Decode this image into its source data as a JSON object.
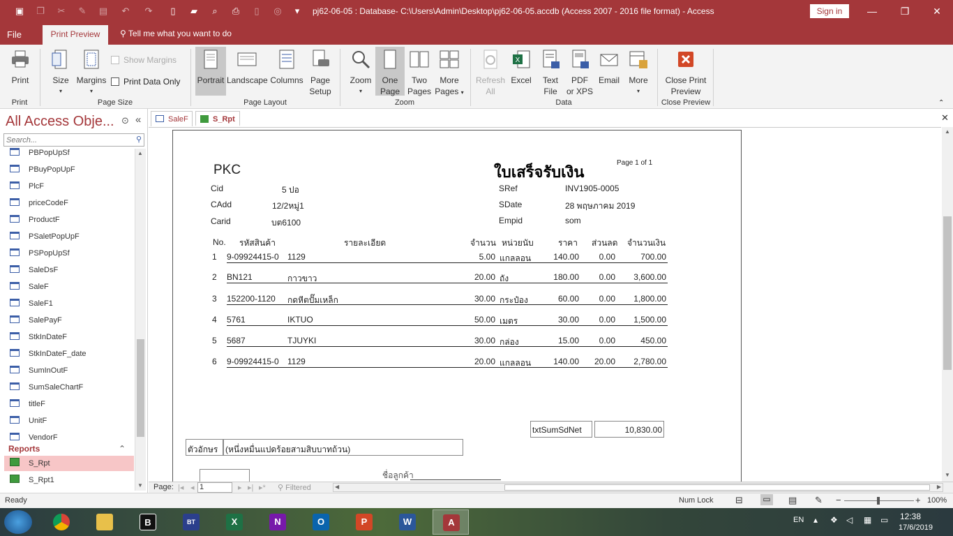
{
  "titlebar": {
    "title": "pj62-06-05 : Database- C:\\Users\\Admin\\Desktop\\pj62-06-05.accdb (Access 2007 - 2016 file format)  -  Access",
    "sign_in": "Sign in"
  },
  "tabs": {
    "file": "File",
    "print_preview": "Print Preview",
    "tell_me": "Tell me what you want to do"
  },
  "ribbon": {
    "print": "Print",
    "group_print": "Print",
    "size": "Size",
    "margins": "Margins",
    "show_margins": "Show Margins",
    "print_data_only": "Print Data Only",
    "group_page_size": "Page Size",
    "portrait": "Portrait",
    "landscape": "Landscape",
    "columns": "Columns",
    "page_setup_1": "Page",
    "page_setup_2": "Setup",
    "group_page_layout": "Page Layout",
    "zoom": "Zoom",
    "one_page_1": "One",
    "one_page_2": "Page",
    "two_pages_1": "Two",
    "two_pages_2": "Pages",
    "more_pages_1": "More",
    "more_pages_2": "Pages",
    "group_zoom": "Zoom",
    "refresh_1": "Refresh",
    "refresh_2": "All",
    "excel": "Excel",
    "text_file_1": "Text",
    "text_file_2": "File",
    "pdf_1": "PDF",
    "pdf_2": "or XPS",
    "email": "Email",
    "more": "More",
    "group_data": "Data",
    "close_1": "Close Print",
    "close_2": "Preview",
    "group_close": "Close Preview"
  },
  "nav": {
    "title": "All Access Obje...",
    "search_placeholder": "Search...",
    "forms": [
      "PBPopUpSf",
      "PBuyPopUpF",
      "PlcF",
      "priceCodeF",
      "ProductF",
      "PSaletPopUpF",
      "PSPopUpSf",
      "SaleDsF",
      "SaleF",
      "SaleF1",
      "SalePayF",
      "StkInDateF",
      "StkInDateF_date",
      "SumInOutF",
      "SumSaleChartF",
      "titleF",
      "UnitF",
      "VendorF"
    ],
    "reports_header": "Reports",
    "reports": [
      "S_Rpt",
      "S_Rpt1"
    ]
  },
  "doc_tabs": {
    "tab1": "SaleF",
    "tab2": "S_Rpt"
  },
  "report": {
    "company": "PKC",
    "title": "ใบเสร็จรับเงิน",
    "page_info": "Page 1 of 1",
    "cid_label": "Cid",
    "cid": "5 ปอ",
    "cadd_label": "CAdd",
    "cadd": "12/2หมู่1",
    "carid_label": "Carid",
    "carid": "บต6100",
    "sref_label": "SRef",
    "sref": "INV1905-0005",
    "sdate_label": "SDate",
    "sdate": "28 พฤษภาคม 2019",
    "empid_label": "Empid",
    "empid": "som",
    "columns": {
      "no": "No.",
      "code": "รหัสสินค้า",
      "desc": "รายละเอียด",
      "qty": "จำนวน",
      "unit": "หน่วยนับ",
      "price": "ราคา",
      "discount": "ส่วนลด",
      "amount": "จำนวนเงิน"
    },
    "rows": [
      {
        "no": "1",
        "code": "9-09924415-0",
        "desc": "1129",
        "qty": "5.00",
        "unit": "แกลลอน",
        "price": "140.00",
        "discount": "0.00",
        "amount": "700.00"
      },
      {
        "no": "2",
        "code": "BN121",
        "desc": "กาวขาว",
        "qty": "20.00",
        "unit": "ถัง",
        "price": "180.00",
        "discount": "0.00",
        "amount": "3,600.00"
      },
      {
        "no": "3",
        "code": "152200-1120",
        "desc": "กดหีตปั๊มเหล็ก",
        "qty": "30.00",
        "unit": "กระป๋อง",
        "price": "60.00",
        "discount": "0.00",
        "amount": "1,800.00"
      },
      {
        "no": "4",
        "code": "5761",
        "desc": "IKTUO",
        "qty": "50.00",
        "unit": "เมตร",
        "price": "30.00",
        "discount": "0.00",
        "amount": "1,500.00"
      },
      {
        "no": "5",
        "code": "5687",
        "desc": "TJUYKI",
        "qty": "30.00",
        "unit": "กล่อง",
        "price": "15.00",
        "discount": "0.00",
        "amount": "450.00"
      },
      {
        "no": "6",
        "code": "9-09924415-0",
        "desc": "1129",
        "qty": "20.00",
        "unit": "แกลลอน",
        "price": "140.00",
        "discount": "20.00",
        "amount": "2,780.00"
      }
    ],
    "sum_label": "txtSumSdNet",
    "sum_value": "10,830.00",
    "words_label": "ตัวอักษร",
    "words_value": "(หนึ่งหมื่นแปดร้อยสามสิบบาทถ้วน)",
    "customer_sign": "ชื่อลูกค้า"
  },
  "pagebar": {
    "label": "Page:",
    "current": "1",
    "filter": "Filtered"
  },
  "status": {
    "ready": "Ready",
    "numlock": "Num Lock",
    "zoom": "100%"
  },
  "taskbar": {
    "lang": "EN",
    "time": "12:38",
    "date": "17/6/2019"
  }
}
